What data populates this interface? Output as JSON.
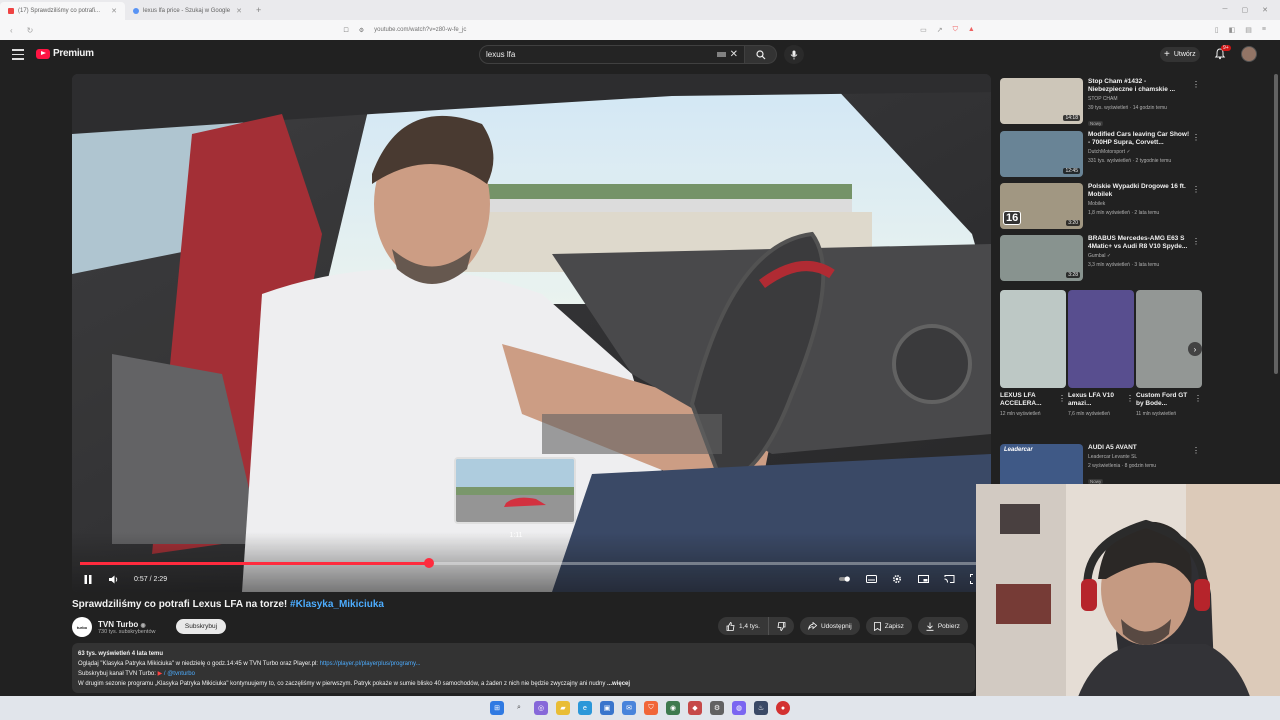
{
  "browser": {
    "tabs": [
      {
        "label": "(17) Sprawdziliśmy co potrafi...",
        "active": true
      },
      {
        "label": "lexus lfa price - Szukaj w Google",
        "active": false
      }
    ],
    "url": "youtube.com/watch?v=z80-w-fe_jc"
  },
  "header": {
    "logo_label": "Premium",
    "search_value": "lexus lfa",
    "create_label": "Utwórz",
    "notifications_badge": "9+"
  },
  "player": {
    "current_time": "0:57",
    "duration": "2:29",
    "time_display": "0:57 / 2:29",
    "played_fraction": 0.39,
    "hover_fraction": 0.49,
    "preview_time": "1:11"
  },
  "video": {
    "title": "Sprawdziliśmy co potrafi Lexus LFA na torze!",
    "title_tag": "#Klasyka_Mikiciuka",
    "channel_name": "TVN Turbo",
    "channel_avatar_text": "turbo",
    "subscribers": "730 tys. subskrybentów",
    "subscribe_label": "Subskrybuj",
    "likes": "1,4 tys.",
    "share_label": "Udostępnij",
    "save_label": "Zapisz",
    "download_label": "Pobierz"
  },
  "description": {
    "meta": "63 tys. wyświetleń  4 lata temu",
    "line1": "Oglądaj \"Klasyka Patryka Mikiciuka\" w niedzielę o godz.14:45 w TVN Turbo oraz Player.pl: ",
    "line1_link": "https://player.pl/playerplus/programy...",
    "line2": "Subskrybuj kanał TVN Turbo: ",
    "line2_link": "/ @tvnturbo",
    "line3": "W drugim sezonie programu „Klasyka Patryka Mikiciuka\" kontynuujemy to, co zaczęliśmy w pierwszym. Patryk pokaże w sumie blisko 40 samochodów, a żaden z nich nie będzie zwyczajny ani nudny ",
    "more_label": "...więcej"
  },
  "recommendations": [
    {
      "title": "Stop Cham #1432 - Niebezpieczne i chamskie ...",
      "channel": "STOP CHAM",
      "meta": "39 tys. wyświetleń · 14 godzin temu",
      "badge": "Nowy",
      "duration": "14:18",
      "thumb_color": "#c9c2b4"
    },
    {
      "title": "Modified Cars leaving Car Show! - 700HP Supra, Corvett...",
      "channel": "DutchMotorsport ✓",
      "meta": "331 tys. wyświetleń · 2 tygodnie temu",
      "badge": "",
      "duration": "12:45",
      "thumb_color": "#5d7a8e"
    },
    {
      "title": "Polskie Wypadki Drogowe 16 ft. Mobilek",
      "channel": "Mobilek",
      "meta": "1,8 mln wyświetleń · 2 lata temu",
      "badge": "",
      "duration": "3:20",
      "thumb_color": "#9a8f78",
      "overlay": "16"
    },
    {
      "title": "BRABUS Mercedes-AMG E63 S 4Matic+ vs Audi R8 V10 Spyde...",
      "channel": "Gumbal ✓",
      "meta": "3,3 mln wyświetleń · 3 lata temu",
      "badge": "",
      "duration": "3:28",
      "thumb_color": "#7e8a86"
    }
  ],
  "shorts": [
    {
      "title": "LEXUS LFA ACCELERA...",
      "views": "12 mln wyświetleń",
      "color": "#b8c4c0"
    },
    {
      "title": "Lexus LFA V10 amazi...",
      "views": "7,6 mln wyświetleń",
      "color": "#4a3f86"
    },
    {
      "title": "Custom Ford GT by Bode...",
      "views": "11 mln wyświetleń",
      "color": "#8a8f8d"
    }
  ],
  "last_rec": {
    "title": "AUDI A5 AVANT",
    "channel": "Leadercar Levante SL",
    "meta": "2 wyświetlenia · 8 godzin temu",
    "badge": "Nowy",
    "thumb_color": "#2f4b7c",
    "overlay": "Leadercar"
  },
  "colors": {
    "accent": "#ff0033",
    "link": "#3ea6ff",
    "progress": "#ff1a2e"
  }
}
